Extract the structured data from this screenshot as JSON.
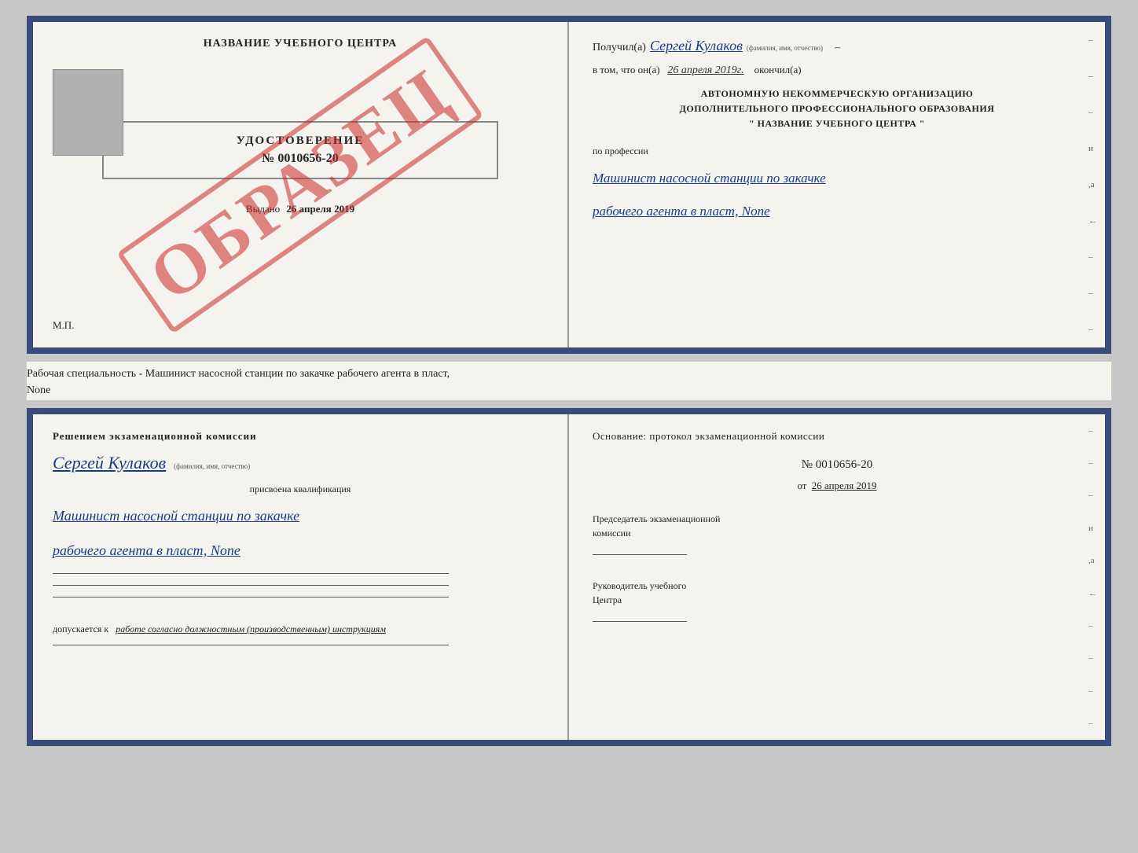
{
  "top_doc": {
    "left": {
      "title": "НАЗВАНИЕ УЧЕБНОГО ЦЕНТРА",
      "udostoverenie": "УДОСТОВЕРЕНИЕ",
      "number": "№ 0010656-20",
      "vydano": "Выдано",
      "vydano_date": "26 апреля 2019",
      "mp": "М.П.",
      "watermark": "ОБРАЗЕЦ"
    },
    "right": {
      "poluchil_label": "Получил(а)",
      "poluchil_name": "Сергей Кулаков",
      "fio_hint": "(фамилия, имя, отчество)",
      "dash": "–",
      "vtom_label": "в том, что он(а)",
      "vtom_date": "26 апреля 2019г.",
      "okonchil": "окончил(а)",
      "org_line1": "АВТОНОМНУЮ НЕКОММЕРЧЕСКУЮ ОРГАНИЗАЦИЮ",
      "org_line2": "ДОПОЛНИТЕЛЬНОГО ПРОФЕССИОНАЛЬНОГО ОБРАЗОВАНИЯ",
      "org_line3": "\"   НАЗВАНИЕ УЧЕБНОГО ЦЕНТРА   \"",
      "po_professii": "по профессии",
      "profession_line1": "Машинист насосной станции по закачке",
      "profession_line2": "рабочего агента в пласт, None",
      "dashes": [
        "-",
        "-",
        "-",
        "и",
        ",а",
        "←",
        "-",
        "-",
        "-"
      ]
    }
  },
  "separator": {
    "text": "Рабочая специальность - Машинист насосной станции по закачке рабочего агента в пласт,",
    "text2": "None"
  },
  "bottom_doc": {
    "left": {
      "resheniem": "Решением экзаменационной комиссии",
      "name": "Сергей Кулаков",
      "fio_hint": "(фамилия, имя, отчество)",
      "prisvoena": "присвоена квалификация",
      "kvali_line1": "Машинист насосной станции по закачке",
      "kvali_line2": "рабочего агента в пласт, None",
      "dopuskaetsya_prefix": "допускается к",
      "dopuskaetsya_text": "работе согласно должностным (производственным) инструкциям"
    },
    "right": {
      "osnovanie": "Основание: протокол экзаменационной комиссии",
      "protocol_number": "№  0010656-20",
      "ot_prefix": "от",
      "ot_date": "26 апреля 2019",
      "predsedatel_line1": "Председатель экзаменационной",
      "predsedatel_line2": "комиссии",
      "rukovoditel_line1": "Руководитель учебного",
      "rukovoditel_line2": "Центра",
      "dashes": [
        "-",
        "-",
        "-",
        "и",
        ",а",
        "←",
        "-",
        "-",
        "-",
        "-"
      ]
    }
  }
}
